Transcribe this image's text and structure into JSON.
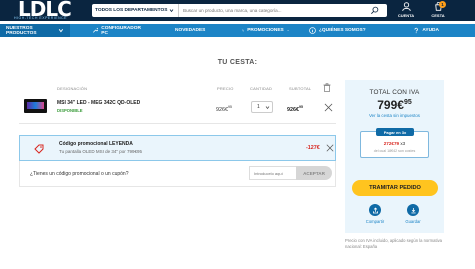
{
  "header": {
    "logo_text": "LDLC",
    "logo_tagline": "HIGH-TECH EXPERIENCE",
    "departments_label": "TODOS LOS DEPARTAMENTOS",
    "search_placeholder": "Buscar un producto, una marca, una categoría...",
    "account_label": "CUENTA",
    "cart_label": "CESTA",
    "cart_count": "1"
  },
  "nav": {
    "items": [
      {
        "label": "NUESTROS PRODUCTOS",
        "icon": "chevron-down-icon"
      },
      {
        "label": "CONFIGURADOR PC",
        "icon": "wrench-icon"
      },
      {
        "label": "NOVEDADES",
        "icon": "sparkle-icon"
      },
      {
        "label": "PROMOCIONES",
        "icon": "percent-icon"
      },
      {
        "label": "¿QUIÉNES SOMOS?",
        "icon": "info-icon"
      },
      {
        "label": "AYUDA",
        "icon": "question-icon"
      }
    ]
  },
  "cart": {
    "title": "TU CESTA:",
    "columns": {
      "designation": "DESIGNACIÓN",
      "price": "PRECIO",
      "quantity": "CANTIDAD",
      "subtotal": "SUBTOTAL"
    },
    "item": {
      "name": "MSI 34\" LED - MEG 342C QD-OLED",
      "stock": "DISPONIBLE",
      "price": "926€",
      "price_cents": "95",
      "quantity": "1",
      "subtotal": "926€",
      "subtotal_cents": "95"
    },
    "promo": {
      "title": "Código promocional LEYENDA",
      "subtitle": "Tu pantalla OLED MSI de 34\" por 799€95",
      "amount": "-127€"
    },
    "coupon": {
      "label": "¿Tienes un código promocional o un cupón?",
      "placeholder": "Introducelo aquí",
      "button": "ACEPTAR"
    }
  },
  "summary": {
    "title": "TOTAL CON IVA",
    "total": "799€",
    "total_cents": "95",
    "no_iva_link": "Ver la cesta sin impuestos",
    "installments": {
      "header": "Pagar en 3x",
      "amount": "272€79",
      "amount_suffix": " x3",
      "note": "del cual 18€42 son costes"
    },
    "checkout_button": "TRAMITAR PEDIDO",
    "share_label": "Compartir",
    "save_label": "Guardar",
    "legal": "Precio con IVA incluido, aplicado según la normativa nacional: España"
  },
  "colors": {
    "topbar": "#0a2540",
    "navbar": "#1c84c6",
    "checkout": "#ffc41f",
    "promo_bg": "#eaf5fc",
    "discount": "#d8261f",
    "in_stock": "#3a9b3a"
  }
}
